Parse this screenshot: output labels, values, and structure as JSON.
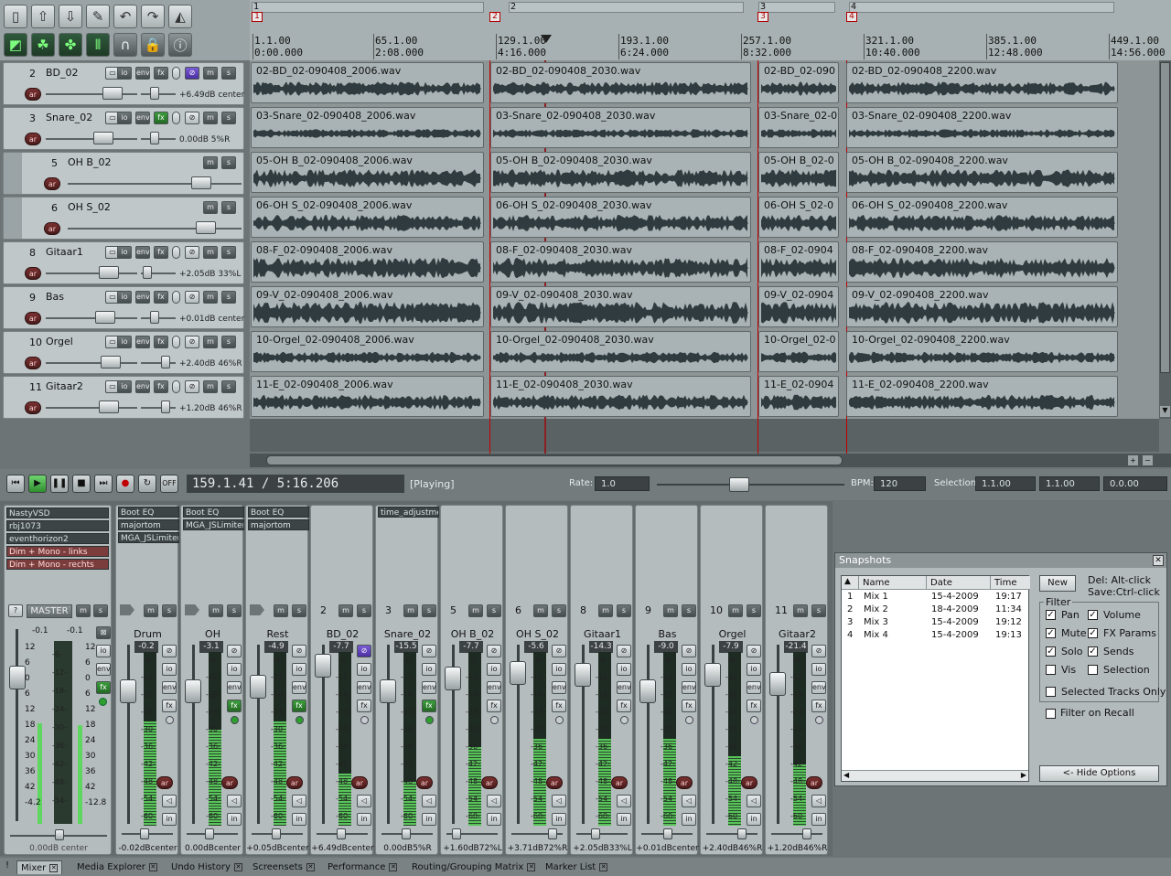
{
  "toolbar": {
    "icons": [
      "new-file-icon",
      "open-icon",
      "save-icon",
      "wrench-icon",
      "undo-icon",
      "redo-icon",
      "metronome-icon",
      "snap-icon",
      "ripple-icon",
      "grouping-icon",
      "grid-icon",
      "loop-icon",
      "lock-icon",
      "info-icon"
    ]
  },
  "ruler": {
    "regions": [
      "1",
      "2",
      "3",
      "4"
    ],
    "markers": [
      "1",
      "2",
      "3",
      "4"
    ],
    "bars": [
      "1.1.00",
      "65.1.00",
      "129.1.00",
      "193.1.00",
      "257.1.00",
      "321.1.00",
      "385.1.00",
      "449.1.00"
    ],
    "times": [
      "0:00.000",
      "2:08.000",
      "4:16.000",
      "6:24.000",
      "8:32.000",
      "10:40.000",
      "12:48.000",
      "14:56.000"
    ]
  },
  "tracks": [
    {
      "num": "2",
      "name": "BD_02",
      "vol": "+6.49dB center",
      "fx_active": false,
      "has_io": true,
      "items": [
        "02-BD_02-090408_2006.wav",
        "02-BD_02-090408_2030.wav",
        "02-BD_02-090",
        "02-BD_02-090408_2200.wav"
      ]
    },
    {
      "num": "3",
      "name": "Snare_02",
      "vol": "0.00dB 5%R",
      "fx_active": true,
      "has_io": true,
      "items": [
        "03-Snare_02-090408_2006.wav",
        "03-Snare_02-090408_2030.wav",
        "03-Snare_02-0",
        "03-Snare_02-090408_2200.wav"
      ]
    },
    {
      "num": "5",
      "name": "OH B_02",
      "vol": "",
      "fx_active": false,
      "has_io": false,
      "items": [
        "05-OH B_02-090408_2006.wav",
        "05-OH B_02-090408_2030.wav",
        "05-OH B_02-0",
        "05-OH B_02-090408_2200.wav"
      ]
    },
    {
      "num": "6",
      "name": "OH S_02",
      "vol": "",
      "fx_active": false,
      "has_io": false,
      "items": [
        "06-OH S_02-090408_2006.wav",
        "06-OH S_02-090408_2030.wav",
        "06-OH S_02-0",
        "06-OH S_02-090408_2200.wav"
      ]
    },
    {
      "num": "8",
      "name": "Gitaar1",
      "vol": "+2.05dB 33%L",
      "fx_active": false,
      "has_io": true,
      "items": [
        "08-F_02-090408_2006.wav",
        "08-F_02-090408_2030.wav",
        "08-F_02-0904",
        "08-F_02-090408_2200.wav"
      ]
    },
    {
      "num": "9",
      "name": "Bas",
      "vol": "+0.01dB center",
      "fx_active": false,
      "has_io": true,
      "items": [
        "09-V_02-090408_2006.wav",
        "09-V_02-090408_2030.wav",
        "09-V_02-0904",
        "09-V_02-090408_2200.wav"
      ]
    },
    {
      "num": "10",
      "name": "Orgel",
      "vol": "+2.40dB 46%R",
      "fx_active": false,
      "has_io": true,
      "items": [
        "10-Orgel_02-090408_2006.wav",
        "10-Orgel_02-090408_2030.wav",
        "10-Orgel_02-0",
        "10-Orgel_02-090408_2200.wav"
      ]
    },
    {
      "num": "11",
      "name": "Gitaar2",
      "vol": "+1.20dB 46%R",
      "fx_active": false,
      "has_io": true,
      "items": [
        "11-E_02-090408_2006.wav",
        "11-E_02-090408_2030.wav",
        "11-E_02-0904",
        "11-E_02-090408_2200.wav"
      ]
    }
  ],
  "transport": {
    "position": "159.1.41 / 5:16.206",
    "state": "[Playing]",
    "rate_label": "Rate:",
    "rate": "1.0",
    "bpm_label": "BPM:",
    "bpm": "120",
    "selection_label": "Selection:",
    "sel_start": "1.1.00",
    "sel_end": "1.1.00",
    "sel_len": "0.0.00",
    "off_label": "OFF"
  },
  "master": {
    "fx": [
      "NastyVSD",
      "rbj1073",
      "eventhorizon2",
      "Dim + Mono - links",
      "Dim + Mono - rechts"
    ],
    "label": "MASTER",
    "peakL": "-0.1",
    "peakR": "-0.1",
    "scaleL": [
      "12",
      "6",
      "0",
      "6",
      "12",
      "18",
      "24",
      "30",
      "36",
      "42",
      "-4.2"
    ],
    "scaleR": [
      "12",
      "6",
      "0",
      "6",
      "12",
      "18",
      "24",
      "30",
      "36",
      "42",
      "-12.8"
    ],
    "center_scale": [
      "-6-",
      "-12-",
      "-18-",
      "-24-",
      "-30-",
      "-36-",
      "-42-",
      "-48-",
      "-54-"
    ],
    "vol": "0.00dB center"
  },
  "strips": [
    {
      "num": "",
      "name": "Drum",
      "peak": "-0.2",
      "foot": "-0.02dBcenter",
      "fx": [
        "Boot EQ",
        "majortom",
        "MGA_JSLimiter"
      ],
      "fxon": false,
      "level": 0.6
    },
    {
      "num": "",
      "name": "OH",
      "peak": "-3.1",
      "foot": "0.00dBcenter",
      "fx": [
        "Boot EQ",
        "MGA_JSLimiter"
      ],
      "fxon": true,
      "level": 0.55
    },
    {
      "num": "",
      "name": "Rest",
      "peak": "-4.9",
      "foot": "+0.05dBcenter",
      "fx": [
        "Boot EQ",
        "majortom"
      ],
      "fxon": true,
      "level": 0.6
    },
    {
      "num": "2",
      "name": "BD_02",
      "peak": "-7.7",
      "foot": "+6.49dBcenter",
      "fx": [],
      "fxon": false,
      "level": 0.3
    },
    {
      "num": "3",
      "name": "Snare_02",
      "peak": "-15.5",
      "foot": "0.00dB5%R",
      "fx": [
        "time_adjustmer"
      ],
      "fxon": true,
      "level": 0.25
    },
    {
      "num": "5",
      "name": "OH B_02",
      "peak": "-7.7",
      "foot": "+1.60dB72%L",
      "fx": [],
      "fxon": false,
      "level": 0.45
    },
    {
      "num": "6",
      "name": "OH S_02",
      "peak": "-5.6",
      "foot": "+3.71dB72%R",
      "fx": [],
      "fxon": false,
      "level": 0.5
    },
    {
      "num": "8",
      "name": "Gitaar1",
      "peak": "-14.3",
      "foot": "+2.05dB33%L",
      "fx": [],
      "fxon": false,
      "level": 0.5
    },
    {
      "num": "9",
      "name": "Bas",
      "peak": "-9.0",
      "foot": "+0.01dBcenter",
      "fx": [],
      "fxon": false,
      "level": 0.5
    },
    {
      "num": "10",
      "name": "Orgel",
      "peak": "-7.9",
      "foot": "+2.40dB46%R",
      "fx": [],
      "fxon": false,
      "level": 0.4
    },
    {
      "num": "11",
      "name": "Gitaar2",
      "peak": "-21.4",
      "foot": "+1.20dB46%R",
      "fx": [],
      "fxon": false,
      "level": 0.35
    }
  ],
  "strip_scale": [
    "-6-",
    "-12-",
    "-18-",
    "-24-",
    "-30-",
    "-36-",
    "-42-",
    "-48-",
    "-54-",
    "-60-"
  ],
  "snapshots": {
    "title": "Snapshots",
    "columns": [
      "Name",
      "Date",
      "Time"
    ],
    "rows": [
      {
        "id": "1",
        "name": "Mix 1",
        "date": "15-4-2009",
        "time": "19:17"
      },
      {
        "id": "2",
        "name": "Mix 2",
        "date": "18-4-2009",
        "time": "11:34"
      },
      {
        "id": "3",
        "name": "Mix 3",
        "date": "15-4-2009",
        "time": "19:12"
      },
      {
        "id": "4",
        "name": "Mix 4",
        "date": "15-4-2009",
        "time": "19:13"
      }
    ],
    "new_label": "New",
    "del_hint": "Del: Alt-click",
    "save_hint": "Save:Ctrl-click",
    "filter_label": "Filter",
    "filters": [
      {
        "label": "Pan",
        "checked": true
      },
      {
        "label": "Volume",
        "checked": true
      },
      {
        "label": "Mute",
        "checked": true
      },
      {
        "label": "FX Params",
        "checked": true
      },
      {
        "label": "Solo",
        "checked": true
      },
      {
        "label": "Sends",
        "checked": true
      },
      {
        "label": "Vis",
        "checked": false
      },
      {
        "label": "Selection",
        "checked": false
      }
    ],
    "selected_only": "Selected Tracks Only",
    "filter_recall": "Filter on Recall",
    "hide_options": "<- Hide Options"
  },
  "tabs": [
    "Mixer",
    "Media Explorer",
    "Undo History",
    "Screensets",
    "Performance",
    "Routing/Grouping Matrix",
    "Marker List"
  ]
}
